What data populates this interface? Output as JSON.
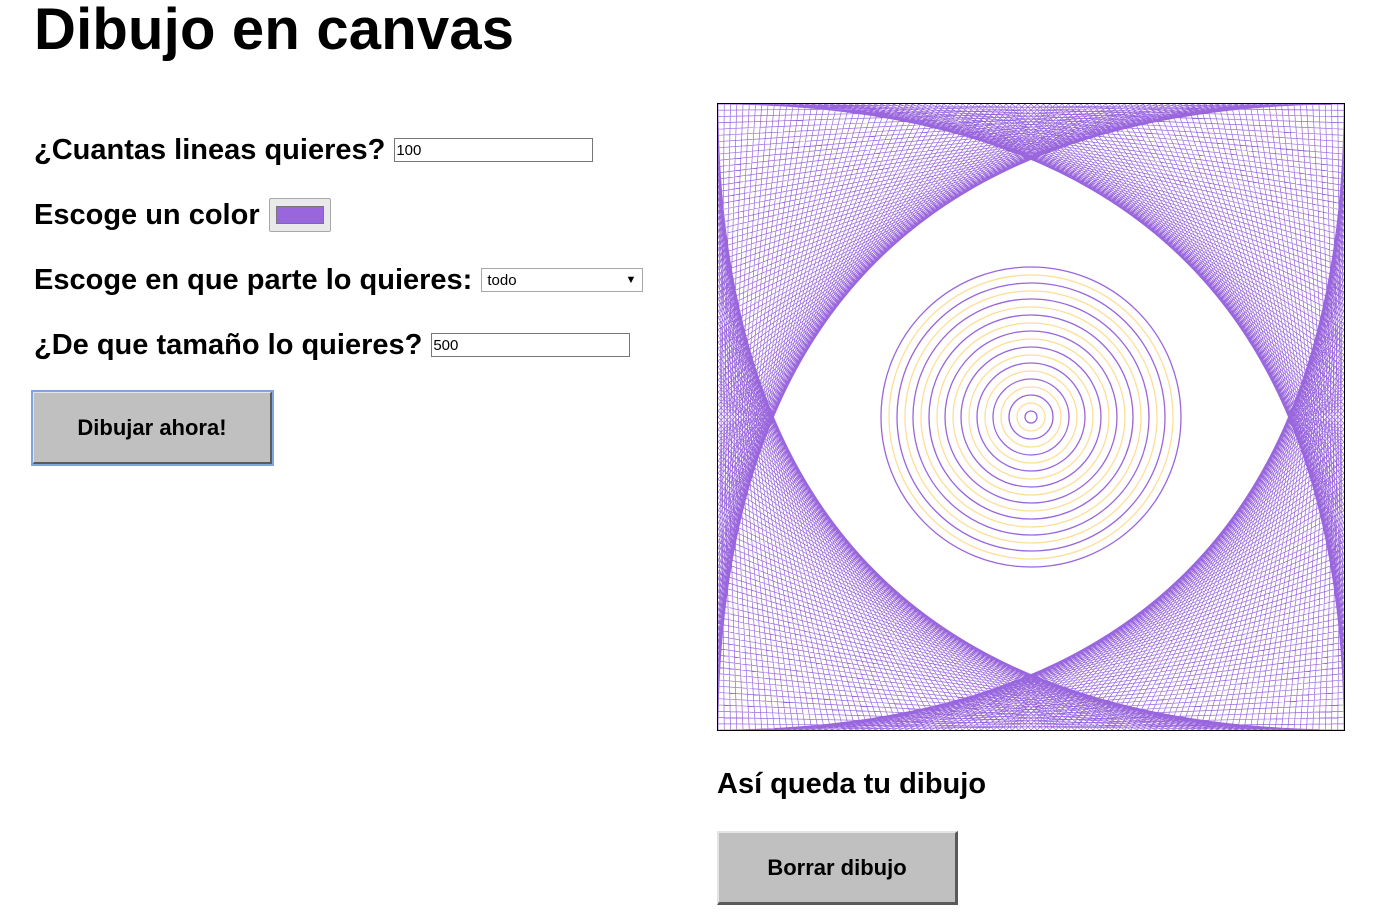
{
  "page": {
    "title": "Dibujo en canvas"
  },
  "form": {
    "lines": {
      "label": "¿Cuantas lineas quieres?",
      "value": "100"
    },
    "color": {
      "label": "Escoge un color",
      "value": "#9966dd"
    },
    "part": {
      "label": "Escoge en que parte lo quieres:",
      "selected": "todo"
    },
    "size": {
      "label": "¿De que tamaño lo quieres?",
      "value": "500"
    },
    "draw_button": "Dibujar ahora!"
  },
  "drawing": {
    "caption": "Así queda tu dibujo",
    "clear_button": "Borrar dibujo",
    "line_color": "#9966dd",
    "ring_colors": [
      "#9966dd",
      "#ffdd99"
    ],
    "ring_count": 19,
    "line_count": 100
  }
}
